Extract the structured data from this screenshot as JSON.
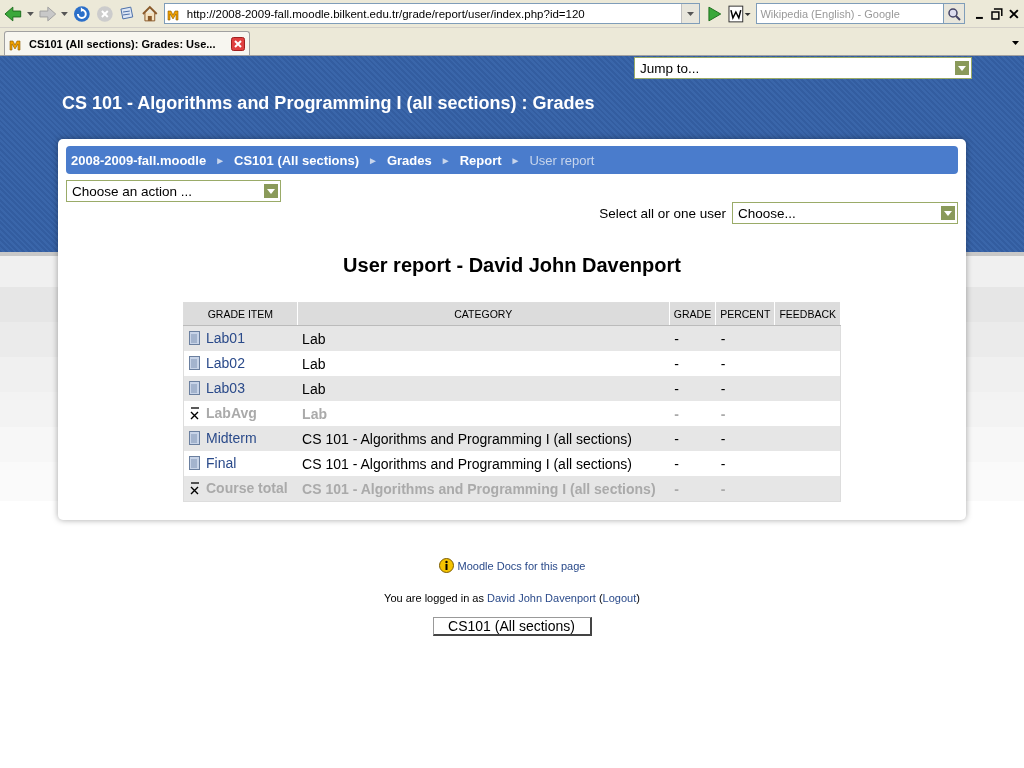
{
  "browser": {
    "url": "http://2008-2009-fall.moodle.bilkent.edu.tr/grade/report/user/index.php?id=120",
    "search_placeholder": "Wikipedia (English) - Google",
    "tab_title": "CS101 (All sections): Grades: Use..."
  },
  "header": {
    "jump_value": "Jump to...",
    "title": "CS 101 - Algorithms and Programming I (all sections) : Grades"
  },
  "breadcrumb": {
    "separator": "►",
    "items": [
      {
        "label": "2008-2009-fall.moodle",
        "current": false
      },
      {
        "label": "CS101 (All sections)",
        "current": false
      },
      {
        "label": "Grades",
        "current": false
      },
      {
        "label": "Report",
        "current": false
      },
      {
        "label": "User report",
        "current": true
      }
    ]
  },
  "action_select": {
    "value": "Choose an action ..."
  },
  "user_select": {
    "label": "Select all or one user",
    "value": "Choose..."
  },
  "report_title": "User report - David John Davenport",
  "table": {
    "columns": [
      "GRADE ITEM",
      "CATEGORY",
      "GRADE",
      "PERCENT",
      "FEEDBACK"
    ],
    "rows": [
      {
        "kind": "grade",
        "item": "Lab01",
        "category": "Lab",
        "grade": "-",
        "percent": "-"
      },
      {
        "kind": "grade",
        "item": "Lab02",
        "category": "Lab",
        "grade": "-",
        "percent": "-"
      },
      {
        "kind": "grade",
        "item": "Lab03",
        "category": "Lab",
        "grade": "-",
        "percent": "-"
      },
      {
        "kind": "aggregate",
        "item": "LabAvg",
        "category": "Lab",
        "grade": "-",
        "percent": "-"
      },
      {
        "kind": "grade",
        "item": "Midterm",
        "category": "CS 101 - Algorithms and Programming I (all sections)",
        "grade": "-",
        "percent": "-"
      },
      {
        "kind": "grade",
        "item": "Final",
        "category": "CS 101 - Algorithms and Programming I (all sections)",
        "grade": "-",
        "percent": "-"
      },
      {
        "kind": "aggregate",
        "item": "Course total",
        "category": "CS 101 - Algorithms and Programming I (all sections)",
        "grade": "-",
        "percent": "-"
      }
    ]
  },
  "footer": {
    "docs_link": "Moodle Docs for this page",
    "login_prefix": "You are logged in as",
    "login_user": "David John Davenport",
    "logout_open": "(",
    "logout_link": "Logout",
    "logout_close": ")",
    "course_button": "CS101 (All sections)"
  }
}
